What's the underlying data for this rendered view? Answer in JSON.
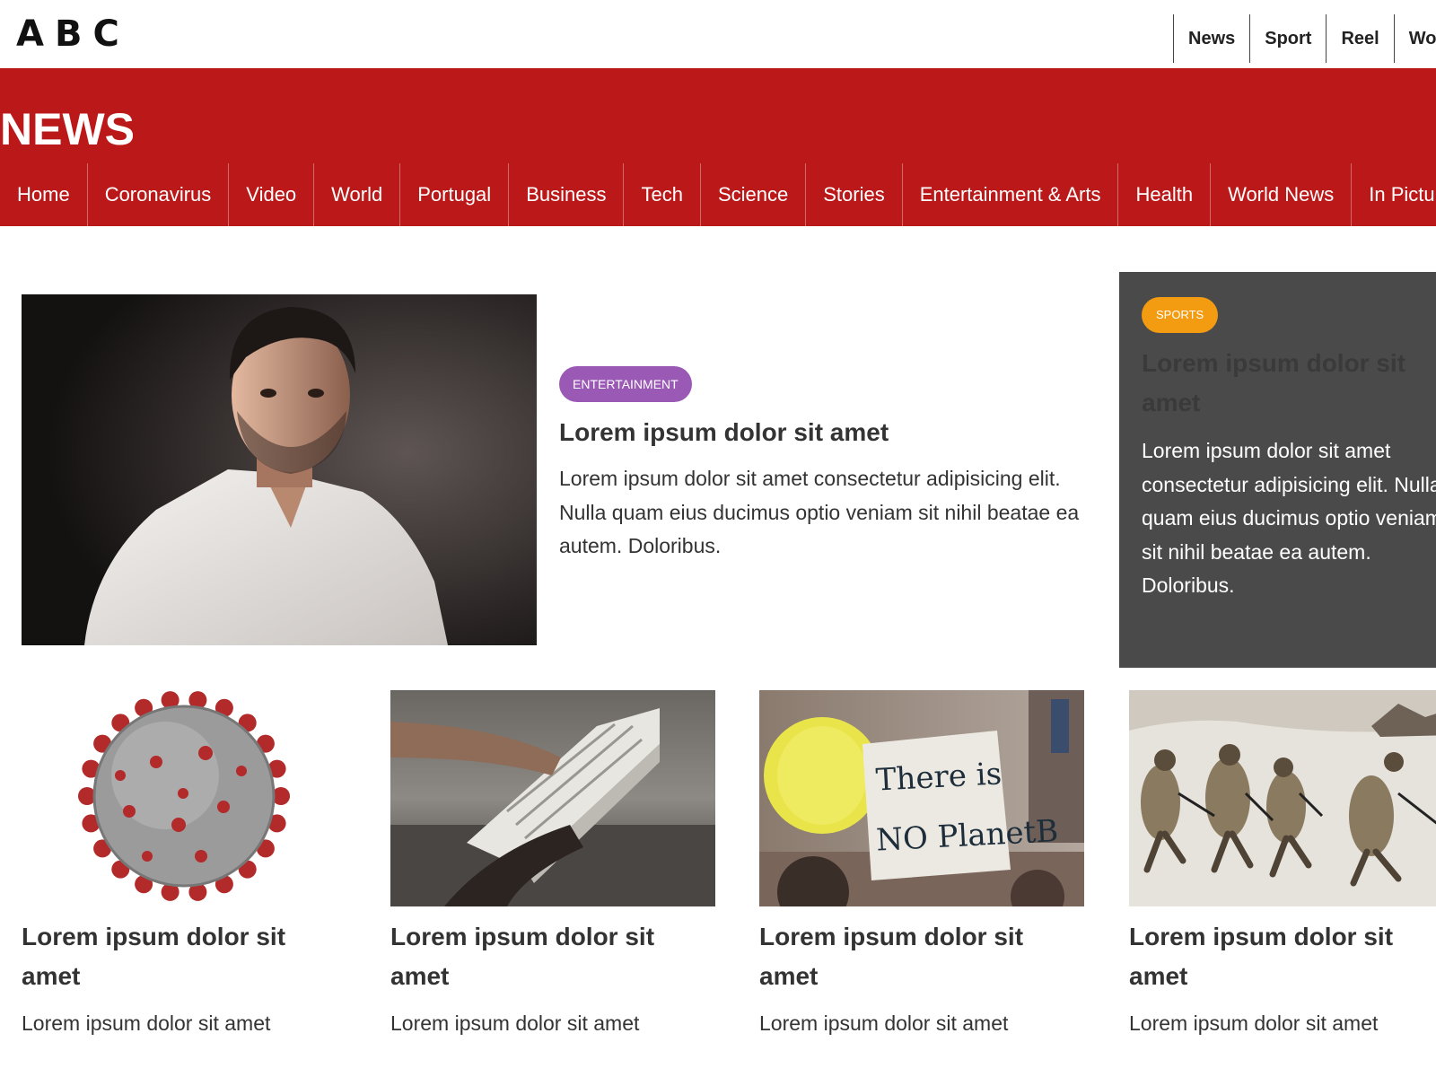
{
  "logo": {
    "letters": [
      "A",
      "B",
      "C"
    ]
  },
  "top_nav": [
    "News",
    "Sport",
    "Reel",
    "Wo"
  ],
  "header": {
    "title": "NEWS"
  },
  "main_nav": [
    "Home",
    "Coronavirus",
    "Video",
    "World",
    "Portugal",
    "Business",
    "Tech",
    "Science",
    "Stories",
    "Entertainment & Arts",
    "Health",
    "World News",
    "In Pictur"
  ],
  "colors": {
    "brand_red": "#bb1919",
    "entertainment_badge": "#9b59b6",
    "sports_badge": "#f39c12",
    "sports_panel": "#4a4a4a"
  },
  "featured": {
    "badge": "ENTERTAINMENT",
    "title": "Lorem ipsum dolor sit amet",
    "text": "Lorem ipsum dolor sit amet consectetur adipisicing elit. Nulla quam eius ducimus optio veniam sit nihil beatae ea autem. Doloribus.",
    "image_icon": "portrait-photo"
  },
  "sports": {
    "badge": "SPORTS",
    "title": "Lorem ipsum dolor sit amet",
    "text": "Lorem ipsum dolor sit amet consectetur adipisicing elit. Nulla quam eius ducimus optio veniam sit nihil beatae ea autem. Doloribus."
  },
  "cards": [
    {
      "title": "Lorem ipsum dolor sit amet",
      "text": "Lorem ipsum dolor sit amet",
      "image_icon": "virus-image"
    },
    {
      "title": "Lorem ipsum dolor sit amet",
      "text": "Lorem ipsum dolor sit amet",
      "image_icon": "newspaper-image"
    },
    {
      "title": "Lorem ipsum dolor sit amet",
      "text": "Lorem ipsum dolor sit amet",
      "image_icon": "protest-sign-image",
      "sign_lines": [
        "There is",
        "NO PlanetB"
      ]
    },
    {
      "title": "Lorem ipsum dolor sit amet",
      "text": "Lorem ipsum dolor sit amet",
      "image_icon": "soldiers-image"
    }
  ]
}
